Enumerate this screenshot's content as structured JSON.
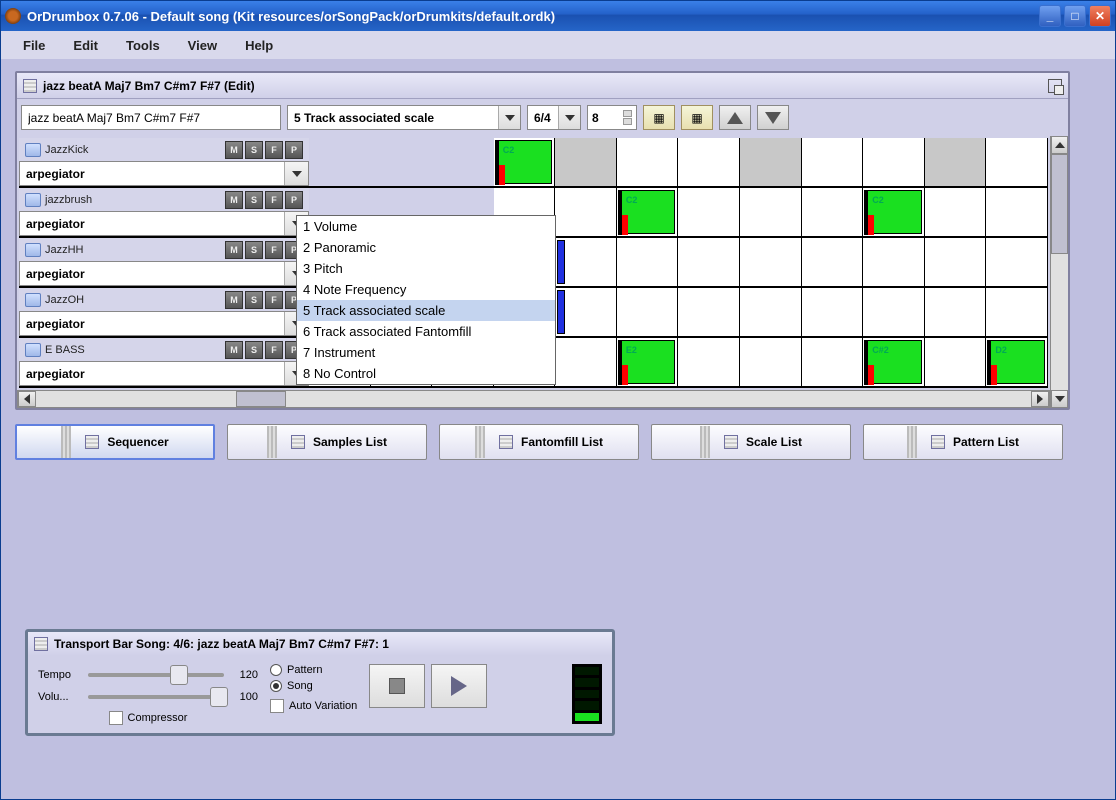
{
  "window": {
    "title": "OrDrumbox 0.7.06 - Default song (Kit resources/orSongPack/orDrumkits/default.ordk)"
  },
  "menu": {
    "file": "File",
    "edit": "Edit",
    "tools": "Tools",
    "view": "View",
    "help": "Help"
  },
  "editor": {
    "title": "jazz beatA Maj7 Bm7 C#m7 F#7 (Edit)",
    "pattern_name": "jazz beatA Maj7 Bm7 C#m7 F#7",
    "combo_selected": "5 Track associated scale",
    "time_sig": "6/4",
    "measure": "8"
  },
  "dropdown": {
    "o1": "1 Volume",
    "o2": "2 Panoramic",
    "o3": "3 Pitch",
    "o4": "4 Note Frequency",
    "o5": "5 Track associated scale",
    "o6": "6 Track associated Fantomfill",
    "o7": "7 Instrument",
    "o8": "8 No Control"
  },
  "track_btns": {
    "m": "M",
    "s": "S",
    "f": "F",
    "p": "P"
  },
  "tracks": {
    "t1": {
      "name": "JazzKick",
      "arp": "arpegiator"
    },
    "t2": {
      "name": "jazzbrush",
      "arp": "arpegiator"
    },
    "t3": {
      "name": "JazzHH",
      "arp": "arpegiator"
    },
    "t4": {
      "name": "JazzOH",
      "arp": "arpegiator"
    },
    "t5": {
      "name": "E BASS",
      "arp": "arpegiator"
    }
  },
  "notes": {
    "c2": "C2",
    "e2": "E2",
    "cs2": "C#2",
    "d2": "D2"
  },
  "tabs": {
    "sequencer": "Sequencer",
    "samples": "Samples List",
    "fantom": "Fantomfill List",
    "scale": "Scale List",
    "pattern": "Pattern List"
  },
  "transport": {
    "title": "Transport Bar Song: 4/6: jazz beatA Maj7 Bm7 C#m7 F#7: 1",
    "tempo_label": "Tempo",
    "tempo_val": "120",
    "volume_label": "Volu...",
    "volume_val": "100",
    "compressor": "Compressor",
    "pattern": "Pattern",
    "song": "Song",
    "auto": "Auto Variation"
  }
}
